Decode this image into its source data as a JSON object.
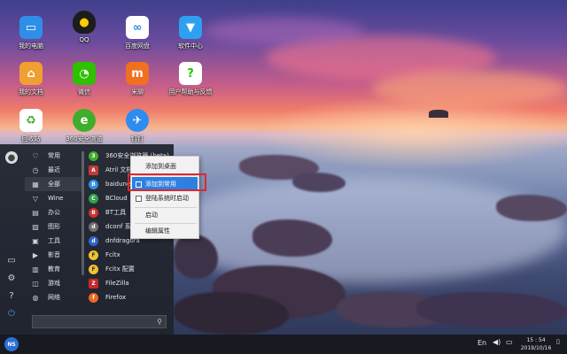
{
  "desktop": {
    "icons": [
      {
        "label": "我的电脑",
        "icon": "computer-icon",
        "color": "#2f8fe8"
      },
      {
        "label": "QQ",
        "icon": "qq-penguin-icon",
        "color": "#1c1c1c"
      },
      {
        "label": "百度网盘",
        "icon": "baidu-netdisk-icon",
        "color": "#ffffff"
      },
      {
        "label": "软件中心",
        "icon": "software-center-bag-icon",
        "color": "#2fa0f0"
      },
      {
        "label": "我的文档",
        "icon": "folder-icon",
        "color": "#f0a030"
      },
      {
        "label": "微信",
        "icon": "wechat-icon",
        "color": "#2dc100"
      },
      {
        "label": "米聊",
        "icon": "miliao-icon",
        "color": "#f07020"
      },
      {
        "label": "用户帮助与反馈",
        "icon": "help-feedback-icon",
        "color": "#ffffff"
      },
      {
        "label": "回收站",
        "icon": "recycle-bin-icon",
        "color": "#ffffff"
      },
      {
        "label": "360安全浏览",
        "icon": "360-browser-icon",
        "color": "#3fae2c"
      },
      {
        "label": "钉钉",
        "icon": "dingtalk-icon",
        "color": "#2d8cf0"
      }
    ]
  },
  "start_menu": {
    "categories": [
      {
        "label": "常用",
        "icon": "heart-icon"
      },
      {
        "label": "最近",
        "icon": "clock-icon"
      },
      {
        "label": "全部",
        "icon": "grid-icon"
      },
      {
        "label": "Wine",
        "icon": "wine-glass-icon"
      },
      {
        "label": "办公",
        "icon": "office-icon"
      },
      {
        "label": "图形",
        "icon": "image-icon"
      },
      {
        "label": "工具",
        "icon": "toolbox-icon"
      },
      {
        "label": "影音",
        "icon": "video-icon"
      },
      {
        "label": "教育",
        "icon": "education-icon"
      },
      {
        "label": "游戏",
        "icon": "gamepad-icon"
      },
      {
        "label": "网络",
        "icon": "globe-icon"
      }
    ],
    "apps": [
      {
        "label": "360安全浏览器 (beta)",
        "icon": "360-browser-icon",
        "color": "#3fae2c",
        "glyph": "3"
      },
      {
        "label": "Atril 文档查看器",
        "icon": "atril-icon",
        "color": "#c23a3a",
        "glyph": "A"
      },
      {
        "label": "baidunetdisk",
        "icon": "baidu-netdisk-icon",
        "color": "#2f8fe8",
        "glyph": "B"
      },
      {
        "label": "BCloud",
        "icon": "bcloud-icon",
        "color": "#31a34a",
        "glyph": "C"
      },
      {
        "label": "BT工具",
        "icon": "bt-tool-icon",
        "color": "#d22f2f",
        "glyph": "B"
      },
      {
        "label": "dconf 系统配置",
        "icon": "dconf-icon",
        "color": "#6f6f6f",
        "glyph": "d"
      },
      {
        "label": "dnfdragora",
        "icon": "dnfdragora-icon",
        "color": "#2e64c8",
        "glyph": "d"
      },
      {
        "label": "Fcitx",
        "icon": "fcitx-icon",
        "color": "#f2c230",
        "glyph": "F"
      },
      {
        "label": "Fcitx 配置",
        "icon": "fcitx-config-icon",
        "color": "#f2c230",
        "glyph": "F"
      },
      {
        "label": "FileZilla",
        "icon": "filezilla-icon",
        "color": "#c8282a",
        "glyph": "Z"
      },
      {
        "label": "Firefox",
        "icon": "firefox-icon",
        "color": "#ee6a1f",
        "glyph": "f"
      }
    ],
    "search": {
      "placeholder": ""
    }
  },
  "left_strip": {
    "items": [
      {
        "icon": "user-avatar-icon"
      },
      {
        "icon": "computer-icon"
      },
      {
        "icon": "settings-gear-icon"
      },
      {
        "icon": "help-icon"
      },
      {
        "icon": "power-icon"
      }
    ]
  },
  "context_menu": {
    "items": [
      {
        "label": "添加到桌面",
        "checkbox": false
      },
      {
        "label": "添加到常用",
        "checkbox": true,
        "highlighted": true
      },
      {
        "label": "登陆系统时启动",
        "checkbox": true
      },
      {
        "label": "启动",
        "checkbox": false
      },
      {
        "label": "编辑属性",
        "checkbox": false
      }
    ],
    "highlight_color": "#2f7fe0",
    "callout_color": "#e0262d"
  },
  "taskbar": {
    "start_label": "NS",
    "language": "En",
    "time": "15 : 54",
    "date": "2019/10/16"
  }
}
